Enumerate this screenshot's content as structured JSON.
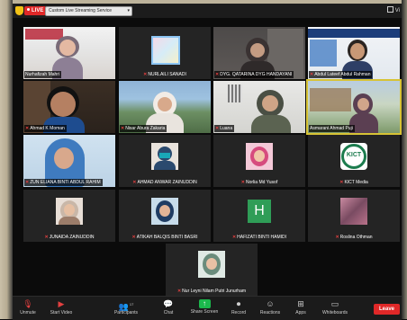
{
  "topbar": {
    "live_label": "LIVE",
    "stream_select_value": "Custom Live Streaming Service",
    "view_label": "Vi"
  },
  "participants": [
    {
      "name": "Nurhafizah Mahri",
      "mic_off": false,
      "type": "video"
    },
    {
      "name": "NURLAILI SANADI",
      "mic_off": true,
      "type": "avatar"
    },
    {
      "name": "DYG. QATARINA DYG HANDAYANI",
      "mic_off": true,
      "type": "video"
    },
    {
      "name": "Abdul Lateef Abdul Rahman",
      "mic_off": true,
      "type": "video"
    },
    {
      "name": "Ahmad K Moman",
      "mic_off": true,
      "type": "video"
    },
    {
      "name": "Nisar Abura Zakaria",
      "mic_off": true,
      "type": "video"
    },
    {
      "name": "Luana",
      "mic_off": true,
      "type": "video"
    },
    {
      "name": "Asmarani Ahmad Puji",
      "mic_off": true,
      "type": "video"
    },
    {
      "name": "ZUN ELIANA BINTI ABDUL RAHIM",
      "mic_off": true,
      "type": "video"
    },
    {
      "name": "AHMAD ANWAR ZAINUDDIN",
      "mic_off": true,
      "type": "avatar"
    },
    {
      "name": "Norlia Md Yusof",
      "mic_off": true,
      "type": "avatar"
    },
    {
      "name": "KICT Media",
      "mic_off": true,
      "type": "avatar",
      "logo_text": "KICT"
    },
    {
      "name": "JUNAIDA ZAINUDDIN",
      "mic_off": true,
      "type": "avatar"
    },
    {
      "name": "ATIKAH BALQIS BINTI BASRI",
      "mic_off": true,
      "type": "avatar"
    },
    {
      "name": "HAFIZATI BINTI HAMIDI",
      "mic_off": true,
      "type": "letter",
      "letter": "H"
    },
    {
      "name": "Roslina Othman",
      "mic_off": true,
      "type": "avatar"
    },
    {
      "name": "Nur Leyni Nilam Putri Junurham",
      "mic_off": true,
      "type": "avatar"
    }
  ],
  "toolbar": {
    "unmute": "Unmute",
    "start_video": "Start Video",
    "participants": "Participants",
    "participants_count": "17",
    "chat": "Chat",
    "share_screen": "Share Screen",
    "record": "Record",
    "reactions": "Reactions",
    "apps": "Apps",
    "whiteboards": "Whiteboards",
    "leave": "Leave"
  },
  "colors": {
    "live_red": "#e02828",
    "share_green": "#1bb84c",
    "active_speaker": "#d7c335",
    "mic_off_red": "#e34040",
    "letter_avatar": "#2f9d57"
  }
}
